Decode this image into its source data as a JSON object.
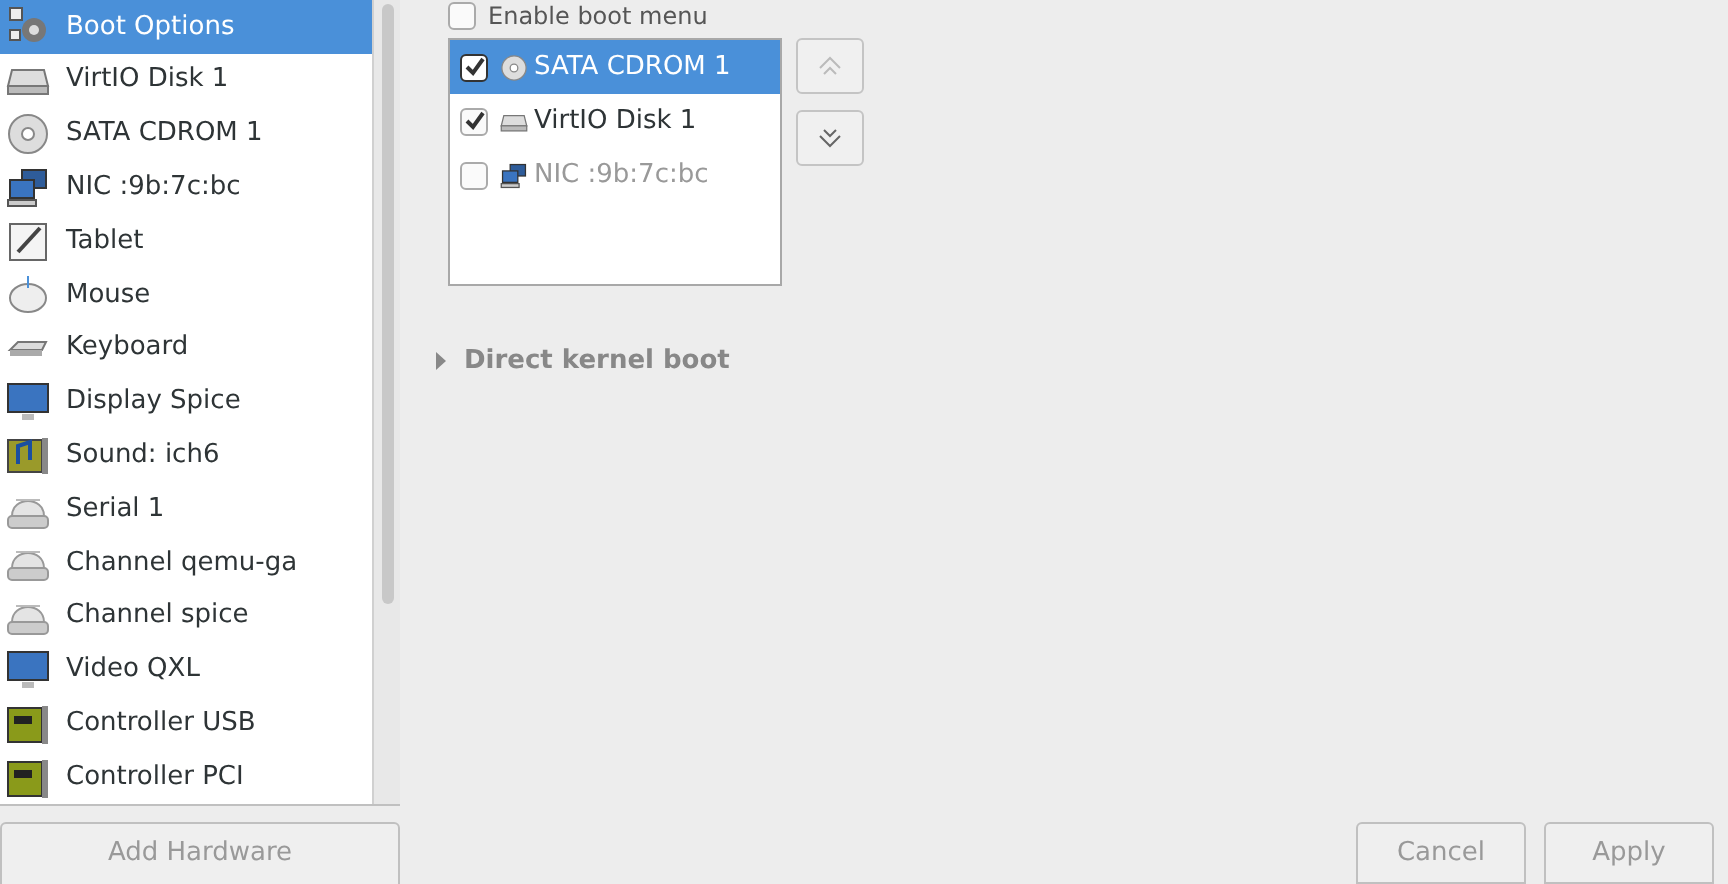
{
  "sidebar": {
    "items": [
      {
        "label": "Boot Options",
        "kind": "gear",
        "selected": true
      },
      {
        "label": "VirtIO Disk 1",
        "kind": "disk",
        "selected": false
      },
      {
        "label": "SATA CDROM 1",
        "kind": "cdrom",
        "selected": false
      },
      {
        "label": "NIC :9b:7c:bc",
        "kind": "network",
        "selected": false
      },
      {
        "label": "Tablet",
        "kind": "tablet",
        "selected": false
      },
      {
        "label": "Mouse",
        "kind": "mouse",
        "selected": false
      },
      {
        "label": "Keyboard",
        "kind": "keyboard",
        "selected": false
      },
      {
        "label": "Display Spice",
        "kind": "monitor",
        "selected": false
      },
      {
        "label": "Sound: ich6",
        "kind": "sound",
        "selected": false
      },
      {
        "label": "Serial 1",
        "kind": "serial",
        "selected": false
      },
      {
        "label": "Channel qemu-ga",
        "kind": "serial",
        "selected": false
      },
      {
        "label": "Channel spice",
        "kind": "serial",
        "selected": false
      },
      {
        "label": "Video QXL",
        "kind": "monitor",
        "selected": false
      },
      {
        "label": "Controller USB",
        "kind": "card",
        "selected": false
      },
      {
        "label": "Controller PCI",
        "kind": "card",
        "selected": false
      }
    ],
    "add_button": {
      "label": "Add Hardware",
      "disabled": true
    }
  },
  "boot_menu": {
    "label": "Enable boot menu",
    "checked": false
  },
  "boot_order": [
    {
      "label": "SATA CDROM 1",
      "kind": "cdrom",
      "checked": true,
      "selected": true
    },
    {
      "label": "VirtIO Disk 1",
      "kind": "disk",
      "checked": true,
      "selected": false
    },
    {
      "label": "NIC :9b:7c:bc",
      "kind": "network",
      "checked": false,
      "selected": false
    }
  ],
  "direct_kernel_boot": {
    "label": "Direct kernel boot",
    "expanded": false
  },
  "buttons": [
    {
      "label": "Cancel",
      "disabled": true
    },
    {
      "label": "Apply",
      "disabled": true
    }
  ]
}
